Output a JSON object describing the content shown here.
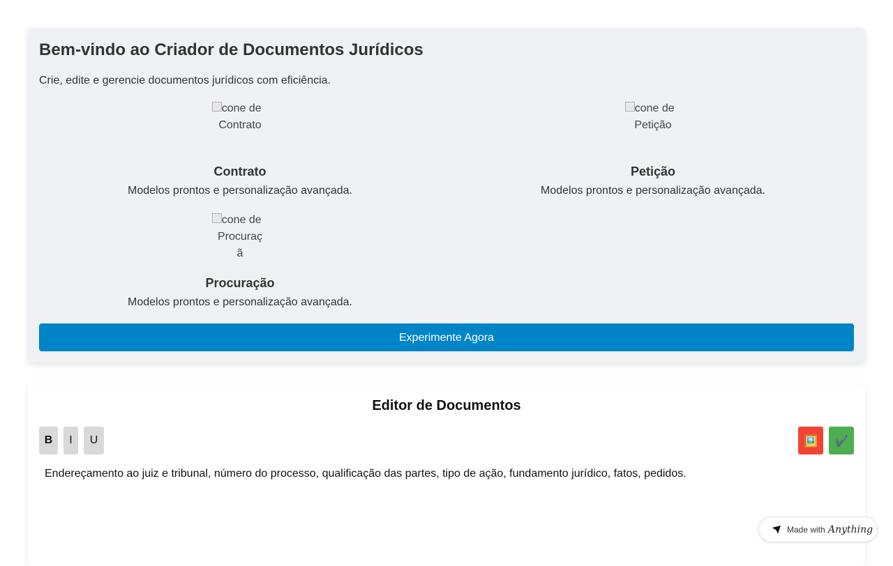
{
  "welcome": {
    "title": "Bem-vindo ao Criador de Documentos Jurídicos",
    "description": "Crie, edite e gerencie documentos jurídicos com eficiência.",
    "cards": [
      {
        "image_alt": "Ícone de Contrato",
        "title": "Contrato",
        "description": "Modelos prontos e personalização avançada."
      },
      {
        "image_alt": "Ícone de Petição",
        "title": "Petição",
        "description": "Modelos prontos e personalização avançada."
      },
      {
        "image_alt": "Ícone de Procuraçã",
        "title": "Procuração",
        "description": "Modelos prontos e personalização avançada."
      }
    ],
    "cta_label": "Experimente Agora"
  },
  "editor": {
    "title": "Editor de Documentos",
    "toolbar": {
      "bold_label": "B",
      "italic_label": "I",
      "underline_label": "U",
      "image_icon": "🖼️",
      "check_icon": "✔️"
    },
    "content": "Endereçamento ao juiz e tribunal, número do processo, qualificação das partes, tipo de ação, fundamento jurídico, fatos, pedidos."
  },
  "badge": {
    "made_with": "Made with",
    "brand": "Anything"
  },
  "colors": {
    "primary": "#0084c8",
    "image_button": "#f44336",
    "check_button": "#4caf50",
    "panel_bg": "#f0f1f5"
  }
}
